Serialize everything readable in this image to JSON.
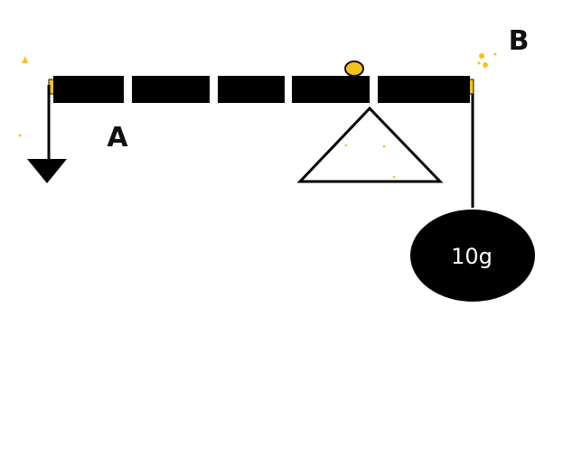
{
  "labels": {
    "point_a": "A",
    "point_b": "B"
  },
  "mass": {
    "text": "10g"
  },
  "colors": {
    "lever": "#000000",
    "pivot_marker": "#f4c21f",
    "mass_fill": "#000000",
    "mass_text": "#ffffff",
    "background": "#ffffff"
  },
  "icons": {
    "fulcrum": "triangle-fulcrum-icon",
    "left_force": "down-arrow-icon",
    "pivot": "yellow-circle-marker"
  }
}
